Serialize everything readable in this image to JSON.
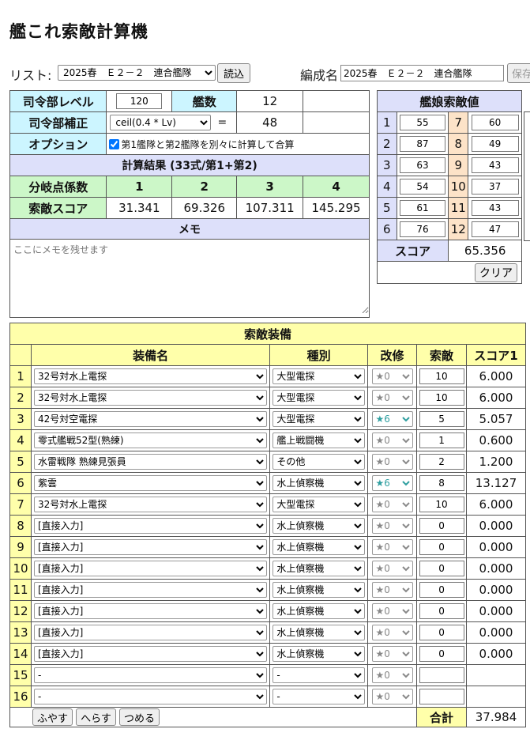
{
  "title": "艦これ索敵計算機",
  "list": {
    "label": "リスト:",
    "selected": "2025春　Ｅ２－２　連合艦隊",
    "load": "読込"
  },
  "fleetname": {
    "label": "編成名",
    "value": "2025春　Ｅ２－２　連合艦隊",
    "save": "保存"
  },
  "hq": {
    "level_label": "司令部レベル",
    "level_value": "120",
    "ships_label": "艦数",
    "ships_value": "12",
    "corr_label": "司令部補正",
    "corr_selected": "ceil(0.4 * Lv)",
    "eq": "=",
    "corr_value": "48",
    "option_label": "オプション",
    "option_text": "第1艦隊と第2艦隊を別々に計算して合算",
    "result_header": "計算結果 (33式/第1+第2)",
    "branch_label": "分岐点係数",
    "branch_values": [
      "1",
      "2",
      "3",
      "4"
    ],
    "score_label": "索敵スコア",
    "score_values": [
      "31.341",
      "69.326",
      "107.311",
      "145.295"
    ],
    "memo_label": "メモ",
    "memo_placeholder": "ここにメモを残せます"
  },
  "ships": {
    "header": "艦娘索敵値",
    "rows": [
      {
        "a": "1",
        "av": "55",
        "b": "7",
        "bv": "60"
      },
      {
        "a": "2",
        "av": "87",
        "b": "8",
        "bv": "49"
      },
      {
        "a": "3",
        "av": "63",
        "b": "9",
        "bv": "43"
      },
      {
        "a": "4",
        "av": "54",
        "b": "10",
        "bv": "37"
      },
      {
        "a": "5",
        "av": "61",
        "b": "11",
        "bv": "43"
      },
      {
        "a": "6",
        "av": "76",
        "b": "12",
        "bv": "47"
      }
    ],
    "score_label": "スコア",
    "score_value": "65.356",
    "clear": "クリア"
  },
  "equip": {
    "header": "索敵装備",
    "cols": {
      "name": "装備名",
      "type": "種別",
      "improve": "改修",
      "los": "索敵",
      "score": "スコア1"
    },
    "rows": [
      {
        "no": "1",
        "name": "32号対水上電探",
        "type": "大型電探",
        "imp": "★0",
        "los": "10",
        "score": "6.000"
      },
      {
        "no": "2",
        "name": "32号対水上電探",
        "type": "大型電探",
        "imp": "★0",
        "los": "10",
        "score": "6.000"
      },
      {
        "no": "3",
        "name": "42号対空電探",
        "type": "大型電探",
        "imp": "★6",
        "los": "5",
        "score": "5.057"
      },
      {
        "no": "4",
        "name": "零式艦戦52型(熟練)",
        "type": "艦上戦闘機",
        "imp": "★0",
        "los": "1",
        "score": "0.600"
      },
      {
        "no": "5",
        "name": "水雷戦隊 熟練見張員",
        "type": "その他",
        "imp": "★0",
        "los": "2",
        "score": "1.200"
      },
      {
        "no": "6",
        "name": "紫雲",
        "type": "水上偵察機",
        "imp": "★6",
        "los": "8",
        "score": "13.127"
      },
      {
        "no": "7",
        "name": "32号対水上電探",
        "type": "大型電探",
        "imp": "★0",
        "los": "10",
        "score": "6.000"
      },
      {
        "no": "8",
        "name": "[直接入力]",
        "type": "水上偵察機",
        "imp": "★0",
        "los": "0",
        "score": "0.000"
      },
      {
        "no": "9",
        "name": "[直接入力]",
        "type": "水上偵察機",
        "imp": "★0",
        "los": "0",
        "score": "0.000"
      },
      {
        "no": "10",
        "name": "[直接入力]",
        "type": "水上偵察機",
        "imp": "★0",
        "los": "0",
        "score": "0.000"
      },
      {
        "no": "11",
        "name": "[直接入力]",
        "type": "水上偵察機",
        "imp": "★0",
        "los": "0",
        "score": "0.000"
      },
      {
        "no": "12",
        "name": "[直接入力]",
        "type": "水上偵察機",
        "imp": "★0",
        "los": "0",
        "score": "0.000"
      },
      {
        "no": "13",
        "name": "[直接入力]",
        "type": "水上偵察機",
        "imp": "★0",
        "los": "0",
        "score": "0.000"
      },
      {
        "no": "14",
        "name": "[直接入力]",
        "type": "水上偵察機",
        "imp": "★0",
        "los": "0",
        "score": "0.000"
      },
      {
        "no": "15",
        "name": "-",
        "type": "-",
        "imp": "★0",
        "los": "",
        "score": ""
      },
      {
        "no": "16",
        "name": "-",
        "type": "-",
        "imp": "★0",
        "los": "",
        "score": ""
      }
    ],
    "buttons": {
      "add": "ふやす",
      "remove": "へらす",
      "compact": "つめる"
    },
    "total_label": "合計",
    "total_value": "37.984"
  },
  "colors": {
    "blue": "#ccf5ff",
    "lavender": "#dde0fa",
    "green": "#ccf7c8",
    "yellow": "#ffffaa",
    "peach": "#fde3c8",
    "star": "#2f9fa0"
  }
}
